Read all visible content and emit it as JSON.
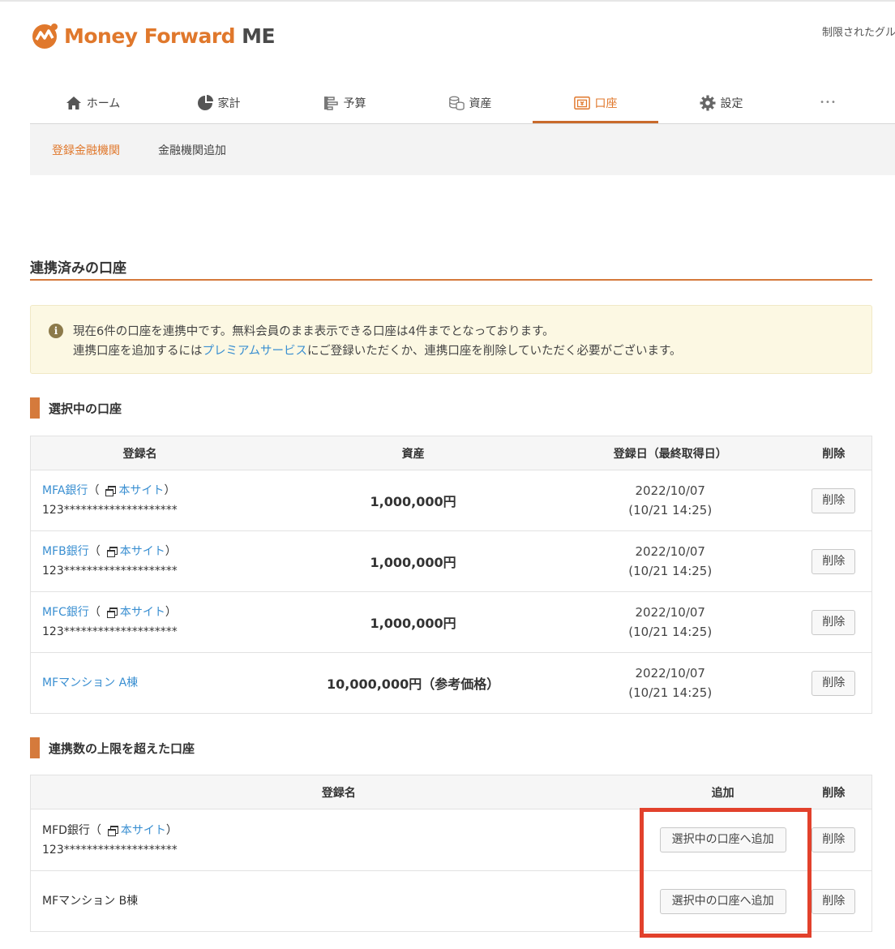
{
  "brand": {
    "name": "Money Forward",
    "suffix": "ME",
    "color": "#e0782c"
  },
  "header": {
    "user_text": "制限されたグル"
  },
  "gnav": [
    {
      "label": "ホーム",
      "icon": "home-icon"
    },
    {
      "label": "家計",
      "icon": "pie-chart-icon"
    },
    {
      "label": "予算",
      "icon": "budget-icon"
    },
    {
      "label": "資産",
      "icon": "coins-icon"
    },
    {
      "label": "口座",
      "icon": "account-icon",
      "active": true
    },
    {
      "label": "設定",
      "icon": "gear-icon"
    },
    {
      "label": "•••",
      "icon": "more-icon"
    }
  ],
  "subnav": [
    {
      "label": "登録金融機関",
      "active": true
    },
    {
      "label": "金融機関追加"
    }
  ],
  "section": {
    "title": "連携済みの口座"
  },
  "notice": {
    "line1": "現在6件の口座を連携中です。無料会員のまま表示できる口座は4件までとなっております。",
    "line2_pre": "連携口座を追加するには",
    "line2_link": "プレミアムサービス",
    "line2_post": "にご登録いただくか、連携口座を削除していただく必要がございます。"
  },
  "selected": {
    "heading": "選択中の口座",
    "headers": {
      "name": "登録名",
      "asset": "資産",
      "date": "登録日（最終取得日）",
      "delete": "削除"
    },
    "rows": [
      {
        "name": "MFA銀行",
        "open": "（",
        "site": "本サイト",
        "close": "）",
        "account": "123********************",
        "asset": "1,000,000円",
        "date": "2022/10/07",
        "fetched": "(10/21 14:25)",
        "delete": "削除"
      },
      {
        "name": "MFB銀行",
        "open": "（",
        "site": "本サイト",
        "close": "）",
        "account": "123********************",
        "asset": "1,000,000円",
        "date": "2022/10/07",
        "fetched": "(10/21 14:25)",
        "delete": "削除"
      },
      {
        "name": "MFC銀行",
        "open": "（",
        "site": "本サイト",
        "close": "）",
        "account": "123********************",
        "asset": "1,000,000円",
        "date": "2022/10/07",
        "fetched": "(10/21 14:25)",
        "delete": "削除"
      },
      {
        "name": "MFマンション A棟",
        "asset": "10,000,000円（参考価格）",
        "date": "2022/10/07",
        "fetched": "(10/21 14:25)",
        "delete": "削除"
      }
    ]
  },
  "over_limit": {
    "heading": "連携数の上限を超えた口座",
    "headers": {
      "name": "登録名",
      "add": "追加",
      "delete": "削除"
    },
    "rows": [
      {
        "name": "MFD銀行",
        "open": "（",
        "site": "本サイト",
        "close": "）",
        "account": "123********************",
        "add": "選択中の口座へ追加",
        "delete": "削除"
      },
      {
        "name": "MFマンション B棟",
        "add": "選択中の口座へ追加",
        "delete": "削除"
      }
    ]
  },
  "colors": {
    "accent": "#e0782c",
    "link": "#3a8fd1",
    "highlight": "#e2412c",
    "notice_bg": "#fcf8e3"
  }
}
